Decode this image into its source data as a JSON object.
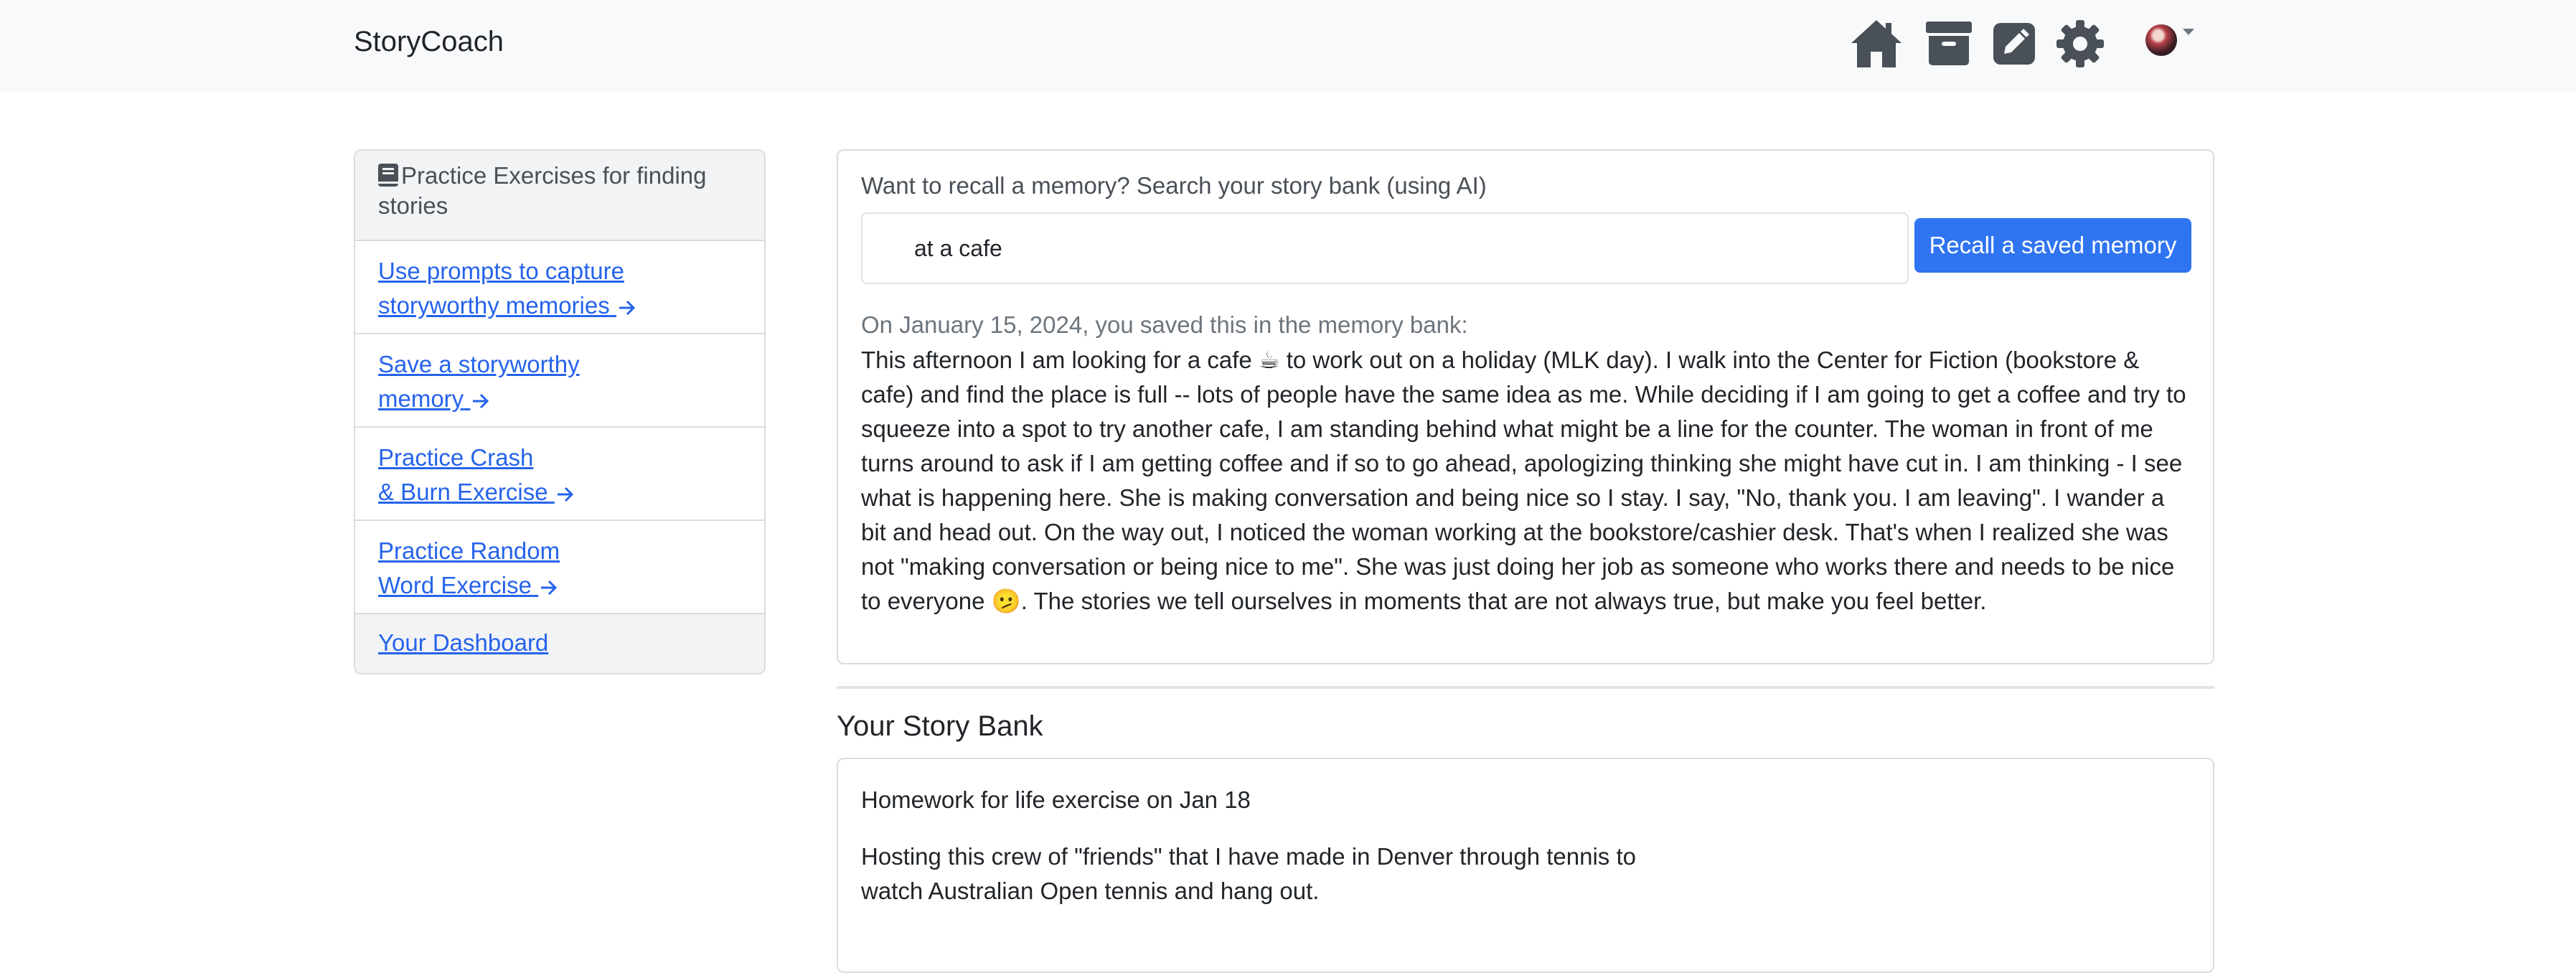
{
  "navbar": {
    "brand": "StoryCoach",
    "icons": [
      "home-icon",
      "archive-icon",
      "edit-icon",
      "settings-icon"
    ],
    "avatar": "user-avatar"
  },
  "sidebar": {
    "header": "Practice Exercises for finding stories",
    "items": [
      {
        "line1": "Use prompts to capture",
        "line2": "storyworthy memories"
      },
      {
        "line1": "Save a storyworthy",
        "line2": "memory"
      },
      {
        "line1": "Practice Crash",
        "line2": "& Burn Exercise"
      },
      {
        "line1": "Practice Random",
        "line2": "Word Exercise"
      }
    ],
    "dashboard": "Your Dashboard"
  },
  "recall": {
    "label": "Want to recall a memory? Search your story bank (using AI)",
    "query": "at a cafe",
    "button": "Recall a saved memory",
    "saved_date": "On January 15, 2024, you saved this in the memory bank:",
    "memory": "This afternoon I am looking for a cafe ☕ to work out on a holiday (MLK day). I walk into the Center for Fiction (bookstore & cafe) and find the place is full -- lots of people have the same idea as me. While deciding if I am going to get a coffee and try to squeeze into a spot to try another cafe, I am standing behind what might be a line for the counter. The woman in front of me turns around to ask if I am getting coffee and if so to go ahead, apologizing thinking she might have cut in. I am thinking - I see what is happening here. She is making conversation and being nice so I stay. I say, \"No, thank you. I am leaving\". I wander a bit and head out. On the way out, I noticed the woman working at the bookstore/cashier desk. That's when I realized she was not \"making conversation or being nice to me\". She was just doing her job as someone who works there and needs to be nice to everyone 🫤. The stories we tell ourselves in moments that are not always true, but make you feel better."
  },
  "story_bank": {
    "title": "Your Story Bank",
    "stories": [
      {
        "title": "Homework for life exercise on Jan 18",
        "text": "Hosting this crew of \"friends\" that I have made in Denver through tennis to watch Australian Open tennis and hang out."
      }
    ]
  },
  "colors": {
    "primary": "#2f74f1",
    "link": "#2563eb",
    "navbar_bg": "#f8f9fa",
    "icon": "#495057"
  }
}
